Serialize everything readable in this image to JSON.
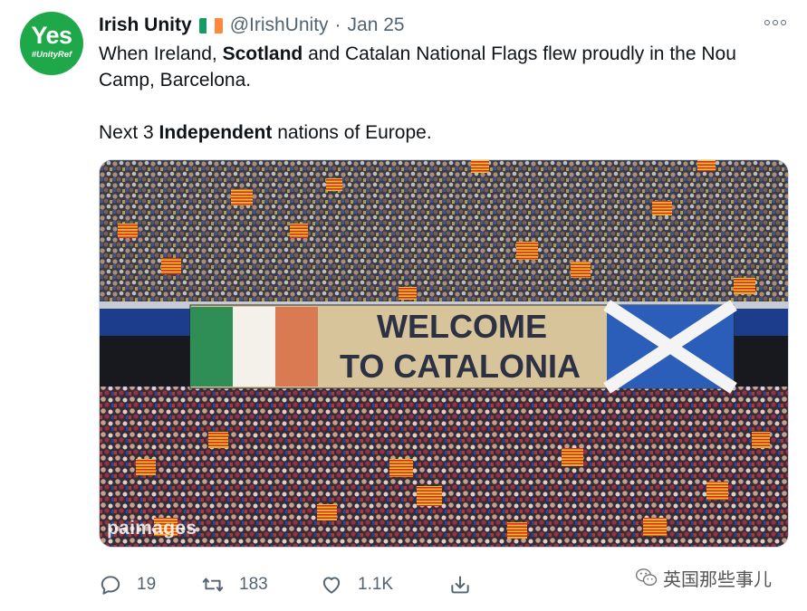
{
  "tweet": {
    "avatar": {
      "main": "Yes",
      "tag": "#UnityRef",
      "color": "#1fa84a"
    },
    "author_name": "Irish Unity",
    "handle": "@IrishUnity",
    "separator": "·",
    "date": "Jan 25",
    "text": {
      "line1_pre": "When Ireland, ",
      "line1_bold": "Scotland",
      "line1_post": " and Catalan National Flags flew proudly in the Nou Camp, Barcelona.",
      "line2_pre": "Next 3 ",
      "line2_bold": "Independent",
      "line2_post": " nations of Europe."
    },
    "media": {
      "banner_line1": "WELCOME",
      "banner_line2": "TO CATALONIA",
      "watermark": "paimages"
    },
    "actions": {
      "reply_count": "19",
      "retweet_count": "183",
      "like_count": "1.1K"
    }
  },
  "source_watermark": "英国那些事儿",
  "icons": [
    "flag-ireland-icon",
    "more-icon",
    "reply-icon",
    "retweet-icon",
    "like-icon",
    "share-icon",
    "wechat-icon"
  ],
  "colors": {
    "text": "#0f1419",
    "muted": "#536471",
    "border": "#cfd9de"
  }
}
